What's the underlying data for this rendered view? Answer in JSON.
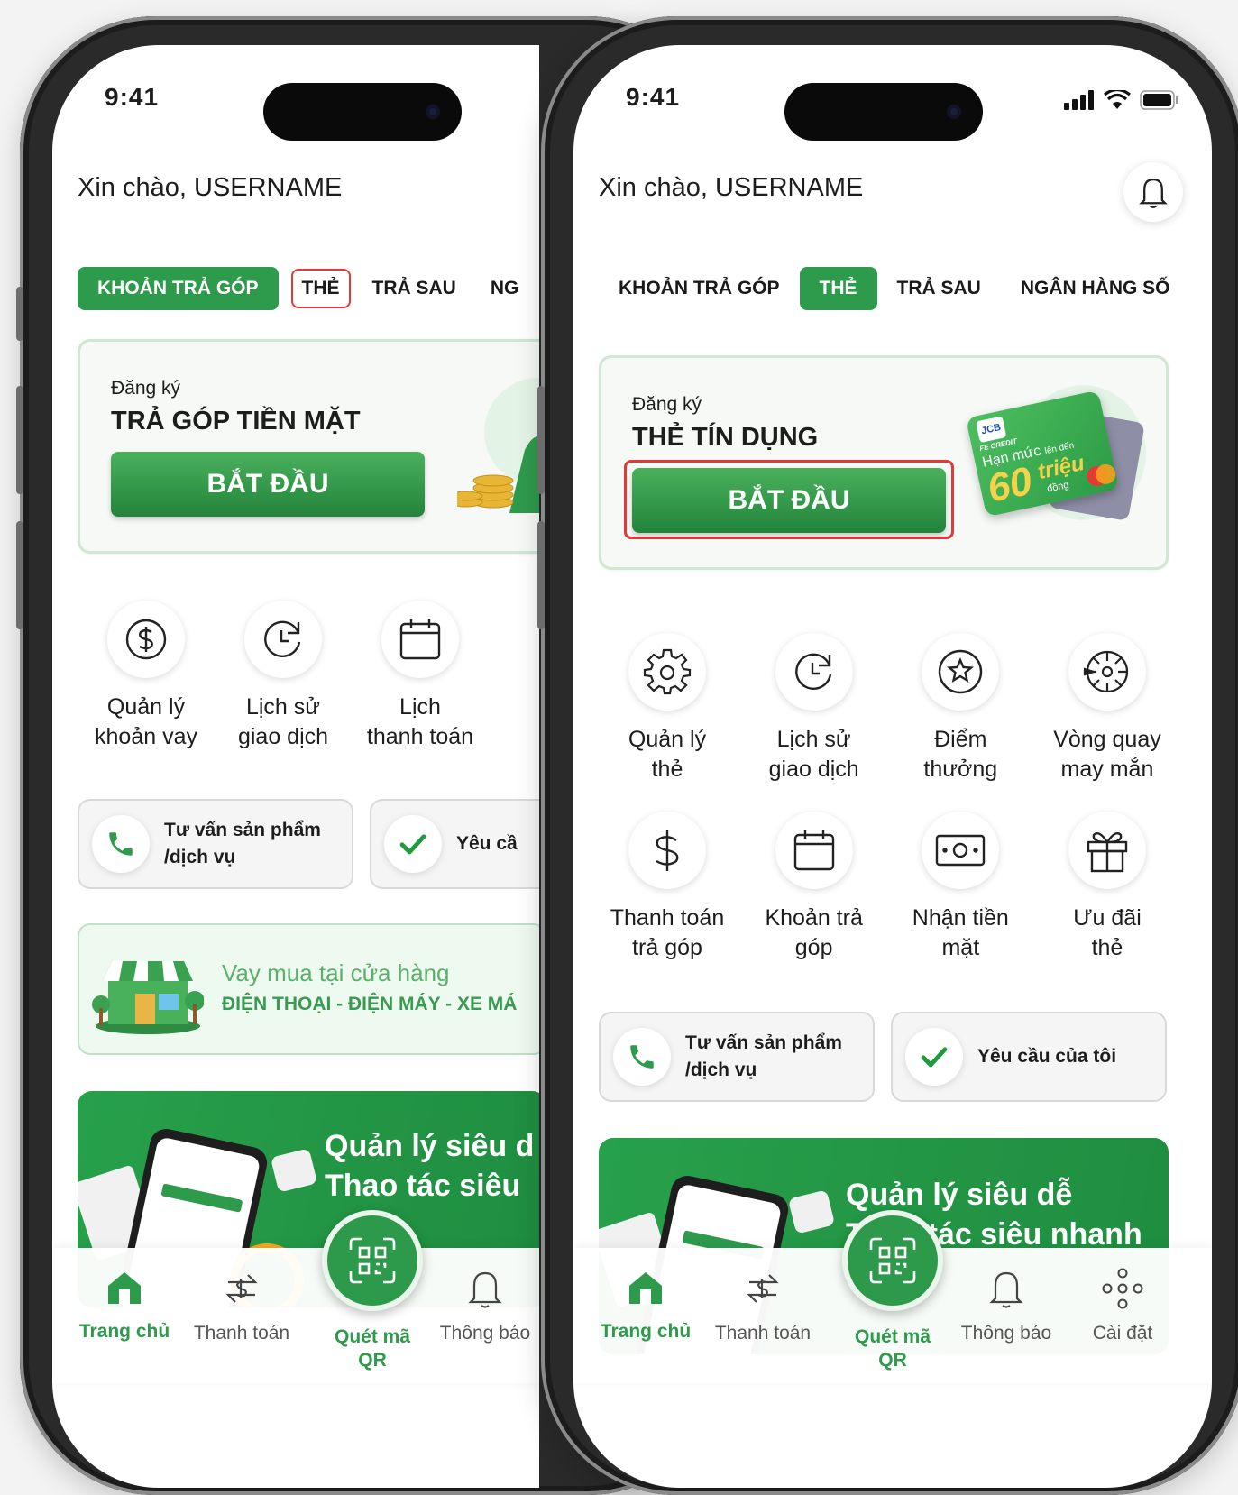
{
  "status_time": "9:41",
  "greeting": "Xin chào, USERNAME",
  "tabs": {
    "installment": "KHOẢN TRẢ GÓP",
    "card": "THẺ",
    "paylater": "TRẢ SAU",
    "digital_bank": "NGÂN HÀNG SỐ",
    "digital_bank_clipped": "NG"
  },
  "screenA": {
    "promo": {
      "sub": "Đăng ký",
      "title": "TRẢ GÓP TIỀN MẶT",
      "button": "BẮT ĐẦU"
    },
    "features": [
      {
        "label": "Quản lý\nkhoản vay",
        "icon": "dollar-icon"
      },
      {
        "label": "Lịch sử\ngiao dịch",
        "icon": "history-icon"
      },
      {
        "label": "Lịch\nthanh toán",
        "icon": "calendar-icon"
      }
    ],
    "consult": "Tư vấn sản phẩm\n/dịch vụ",
    "request_clipped": "Yêu cầ",
    "store": {
      "title": "Vay mua tại cửa hàng",
      "subtitle": "ĐIỆN THOẠI - ĐIỆN MÁY - XE MÁ"
    },
    "banner": {
      "line1": "Quản lý siêu d",
      "line2": "Thao tác siêu"
    }
  },
  "screenB": {
    "promo": {
      "sub": "Đăng ký",
      "title": "THẺ TÍN DỤNG",
      "button": "BẮT ĐẦU"
    },
    "card_art": {
      "issuer": "FE CREDIT",
      "limit_text": "Hạn mức",
      "limit_small": "lên đến",
      "amount": "60",
      "unit": "triệu",
      "currency": "đồng",
      "brand": "JCB"
    },
    "features": [
      {
        "label": "Quản lý\nthẻ",
        "icon": "gear-icon"
      },
      {
        "label": "Lịch sử\ngiao dịch",
        "icon": "history-icon"
      },
      {
        "label": "Điểm\nthưởng",
        "icon": "star-icon"
      },
      {
        "label": "Vòng quay\nmay mắn",
        "icon": "lucky-wheel-icon"
      },
      {
        "label": "Thanh toán\ntrả góp",
        "icon": "dollar-icon"
      },
      {
        "label": "Khoản trả\ngóp",
        "icon": "calendar-icon"
      },
      {
        "label": "Nhận tiền\nmặt",
        "icon": "cash-icon"
      },
      {
        "label": "Ưu đãi\nthẻ",
        "icon": "gift-icon"
      }
    ],
    "consult": "Tư vấn sản phẩm\n/dịch vụ",
    "request": "Yêu cầu của tôi",
    "banner": {
      "line1": "Quản lý siêu dễ",
      "line2": "Thao tác siêu nhanh"
    }
  },
  "nav": {
    "home": "Trang chủ",
    "payment": "Thanh toán",
    "qr": "Quét mã\nQR",
    "notify": "Thông báo",
    "notify_clipped": "Thông báo",
    "settings": "Cài đặt"
  },
  "colors": {
    "primary": "#2e9a4c",
    "highlight": "#e53939",
    "card_green": "#3fae55"
  }
}
